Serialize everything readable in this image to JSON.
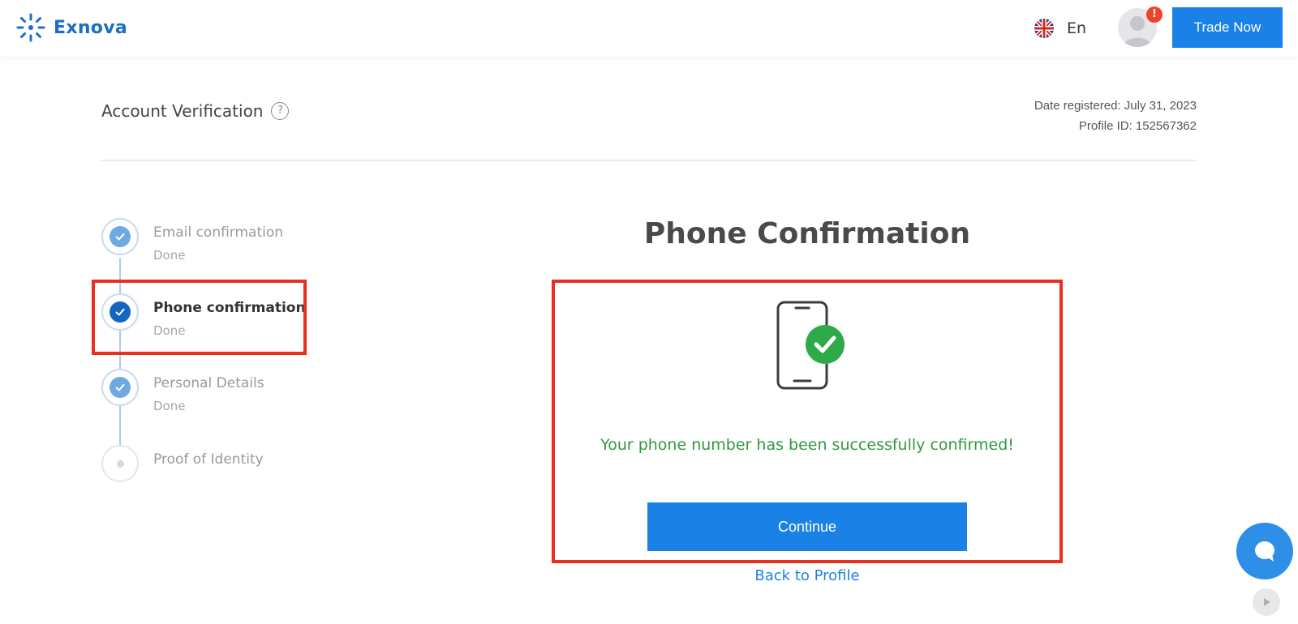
{
  "header": {
    "brand": "Exnova",
    "language": "En",
    "trade_button": "Trade Now",
    "alert_badge": "!"
  },
  "page": {
    "title": "Account Verification",
    "help": "?",
    "date_registered": "Date registered: July 31, 2023",
    "profile_id": "Profile ID: 152567362"
  },
  "steps": [
    {
      "label": "Email confirmation",
      "status": "Done"
    },
    {
      "label": "Phone confirmation",
      "status": "Done"
    },
    {
      "label": "Personal Details",
      "status": "Done"
    },
    {
      "label": "Proof of Identity",
      "status": ""
    }
  ],
  "main": {
    "title": "Phone Confirmation",
    "success_message": "Your phone number has been successfully confirmed!",
    "continue_label": "Continue",
    "back_label": "Back to Profile"
  },
  "colors": {
    "brand_blue": "#1a82e6",
    "success_green": "#2e9a3a",
    "highlight_red": "#e8301e"
  }
}
